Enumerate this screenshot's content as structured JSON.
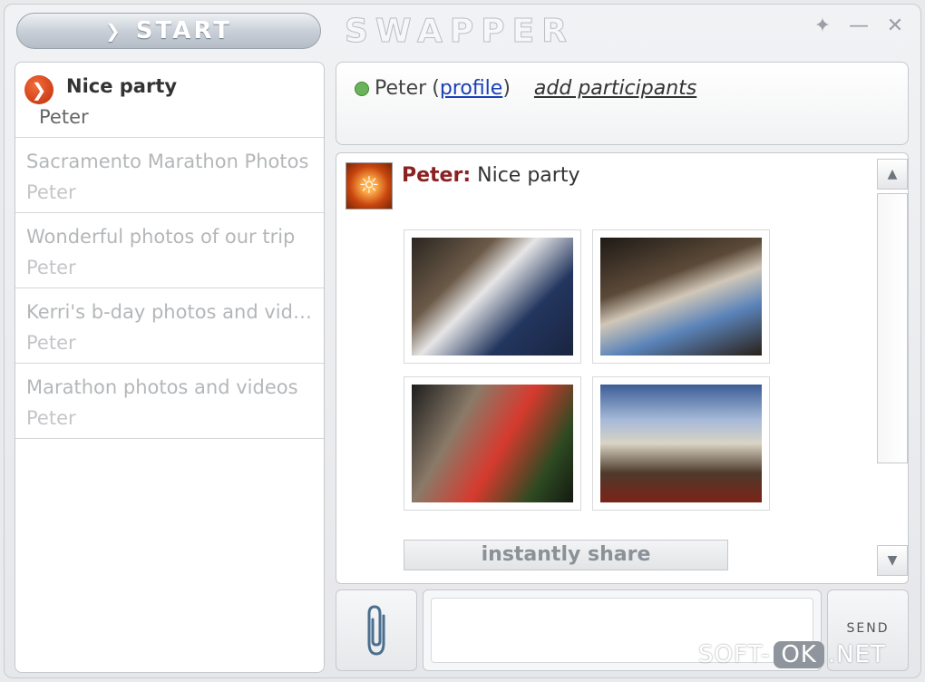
{
  "topbar": {
    "start_label": "START",
    "app_title": "SWAPPER",
    "controls": [
      "settings-icon",
      "minimize-icon",
      "close-icon"
    ]
  },
  "conversations": [
    {
      "title": "Nice party",
      "participant": "Peter",
      "active": true
    },
    {
      "title": "Sacramento Marathon Photos",
      "participant": "Peter",
      "active": false
    },
    {
      "title": "Wonderful photos of our trip",
      "participant": "Peter",
      "active": false
    },
    {
      "title": "Kerri's b-day photos and videos",
      "participant": "Peter",
      "active": false
    },
    {
      "title": "Marathon photos and videos",
      "participant": "Peter",
      "active": false
    }
  ],
  "header": {
    "participant": "Peter",
    "profile_open": "(",
    "profile_link": "profile",
    "profile_close": ")",
    "add_participants": "add participants",
    "status_color": "#6bb35a"
  },
  "chat": {
    "sender": "Peter:",
    "message": " Nice party",
    "share_label": "instantly share",
    "photos": [
      "party-photo-1",
      "party-photo-2",
      "party-photo-3",
      "marathon-photo"
    ]
  },
  "composer": {
    "send_label": "SEND",
    "message_value": ""
  },
  "watermark": {
    "left": "SOFT-",
    "mid": "OK",
    "right": ".NET"
  }
}
